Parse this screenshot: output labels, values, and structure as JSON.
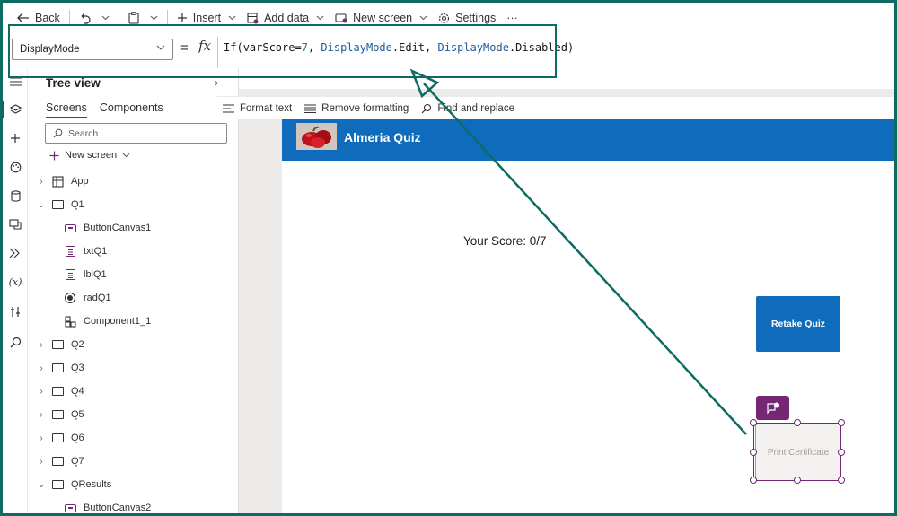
{
  "toolbar": {
    "back_label": "Back",
    "insert_label": "Insert",
    "add_data_label": "Add data",
    "new_screen_label": "New screen",
    "settings_label": "Settings",
    "more_label": "···"
  },
  "formula": {
    "property": "DisplayMode",
    "equals": "=",
    "fx": "fx",
    "tokens": [
      {
        "text": "If(",
        "kind": "plain"
      },
      {
        "text": "varScore",
        "kind": "plain"
      },
      {
        "text": "=",
        "kind": "plain"
      },
      {
        "text": "7",
        "kind": "num"
      },
      {
        "text": ", ",
        "kind": "plain"
      },
      {
        "text": "DisplayMode",
        "kind": "kw"
      },
      {
        "text": ".Edit, ",
        "kind": "plain"
      },
      {
        "text": "DisplayMode",
        "kind": "kw"
      },
      {
        "text": ".Disabled)",
        "kind": "plain"
      }
    ]
  },
  "text_toolbar": {
    "format_text": "Format text",
    "remove_formatting": "Remove formatting",
    "find_replace": "Find and replace"
  },
  "tree": {
    "title": "Tree view",
    "tab_screens": "Screens",
    "tab_components": "Components",
    "search_placeholder": "Search",
    "new_screen": "New screen",
    "items": [
      {
        "label": "App",
        "type": "app",
        "level": 0,
        "expanded": false
      },
      {
        "label": "Q1",
        "type": "screen",
        "level": 0,
        "expanded": true
      },
      {
        "label": "ButtonCanvas1",
        "type": "control",
        "level": 1
      },
      {
        "label": "txtQ1",
        "type": "label",
        "level": 1
      },
      {
        "label": "lblQ1",
        "type": "label",
        "level": 1
      },
      {
        "label": "radQ1",
        "type": "radio",
        "level": 1
      },
      {
        "label": "Component1_1",
        "type": "component",
        "level": 1
      },
      {
        "label": "Q2",
        "type": "screen",
        "level": 0,
        "expanded": false
      },
      {
        "label": "Q3",
        "type": "screen",
        "level": 0,
        "expanded": false
      },
      {
        "label": "Q4",
        "type": "screen",
        "level": 0,
        "expanded": false
      },
      {
        "label": "Q5",
        "type": "screen",
        "level": 0,
        "expanded": false
      },
      {
        "label": "Q6",
        "type": "screen",
        "level": 0,
        "expanded": false
      },
      {
        "label": "Q7",
        "type": "screen",
        "level": 0,
        "expanded": false
      },
      {
        "label": "QResults",
        "type": "screen",
        "level": 0,
        "expanded": true
      },
      {
        "label": "ButtonCanvas2",
        "type": "control",
        "level": 1
      }
    ]
  },
  "canvas": {
    "app_title": "Almeria Quiz",
    "score_text": "Your Score: 0/7",
    "retake_label": "Retake Quiz",
    "print_label": "Print Certificate"
  },
  "colors": {
    "annotation": "#0e6b63",
    "accent": "#742774",
    "header_blue": "#0f6cbd"
  }
}
